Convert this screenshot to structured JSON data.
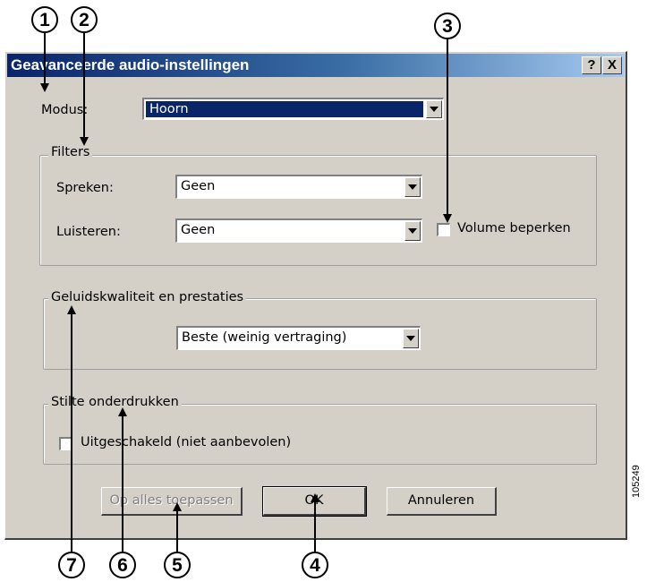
{
  "dialog": {
    "title": "Geavanceerde audio-instellingen",
    "help_button": "?",
    "close_button": "X",
    "mode": {
      "label": "Modus:",
      "value": "Hoorn"
    },
    "filters": {
      "group_label": "Filters",
      "speak_label": "Spreken:",
      "speak_value": "Geen",
      "listen_label": "Luisteren:",
      "listen_value": "Geen",
      "volume_limit_label": "Volume beperken",
      "volume_limit_checked": false
    },
    "quality": {
      "group_label": "Geluidskwaliteit en prestaties",
      "value": "Beste (weinig vertraging)"
    },
    "silence": {
      "group_label": "Stilte onderdrukken",
      "checkbox_label": "Uitgeschakeld (niet aanbevolen)",
      "checked": false
    },
    "buttons": {
      "apply_all": "Op alles toepassen",
      "ok": "OK",
      "cancel": "Annuleren"
    }
  },
  "callouts": [
    "1",
    "2",
    "3",
    "4",
    "5",
    "6",
    "7"
  ],
  "figure_id": "105249",
  "colors": {
    "dialog_face": "#d4d0c8",
    "title_start": "#0a246a",
    "title_end": "#a6caf0",
    "selection": "#0a246a"
  }
}
